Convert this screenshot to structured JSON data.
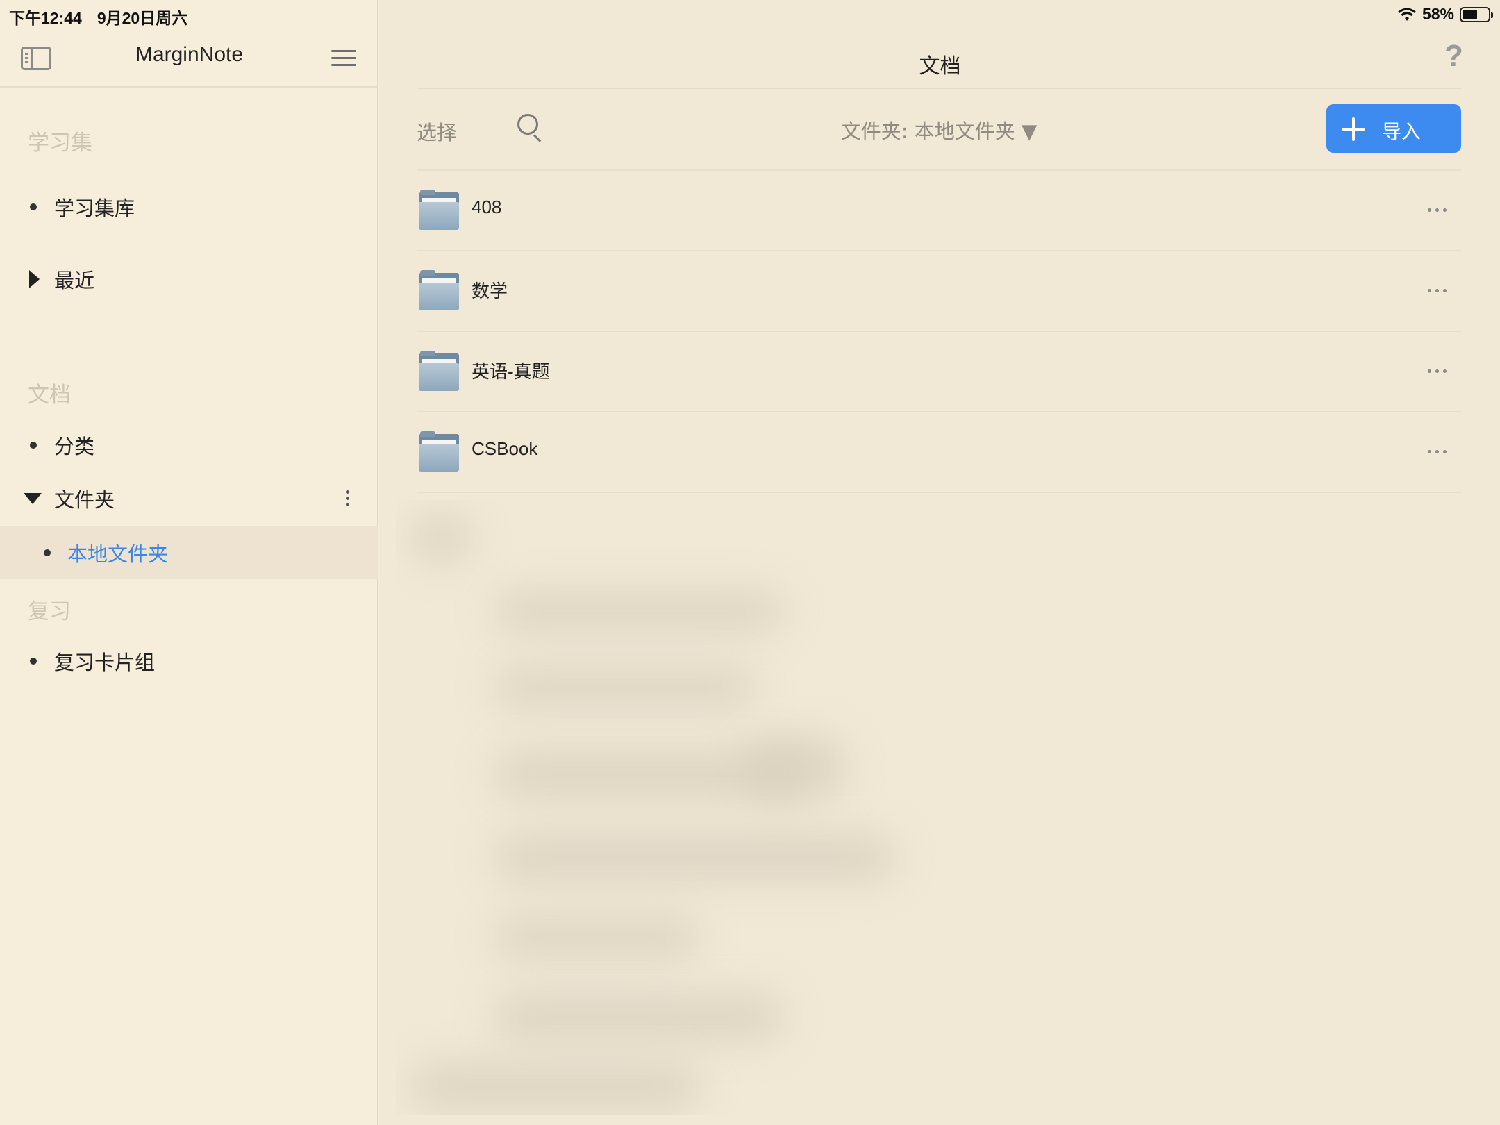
{
  "status_bar": {
    "time": "下午12:44",
    "date": "9月20日周六",
    "battery_text": "58%",
    "battery_level": 0.58
  },
  "sidebar": {
    "app_title": "MarginNote",
    "sections": {
      "study_sets": "学习集",
      "documents": "文档",
      "review": "复习"
    },
    "items": {
      "library": "学习集库",
      "recent": "最近",
      "categories": "分类",
      "folders": "文件夹",
      "local_folder": "本地文件夹",
      "review_decks": "复习卡片组"
    }
  },
  "main": {
    "title": "文档",
    "help": "?",
    "select_label": "选择",
    "folder_filter": "文件夹: 本地文件夹 ▼",
    "import_label": "导入",
    "accent_color": "#3d8bf0",
    "files": [
      {
        "name": "408"
      },
      {
        "name": "数学"
      },
      {
        "name": "英语-真题"
      },
      {
        "name": "CSBook"
      }
    ]
  },
  "icons": [
    "sidebar-toggle-icon",
    "menu-icon",
    "search-icon",
    "plus-icon",
    "folder-icon",
    "more-icon",
    "kebab-icon",
    "help-icon",
    "wifi-icon",
    "battery-icon"
  ]
}
